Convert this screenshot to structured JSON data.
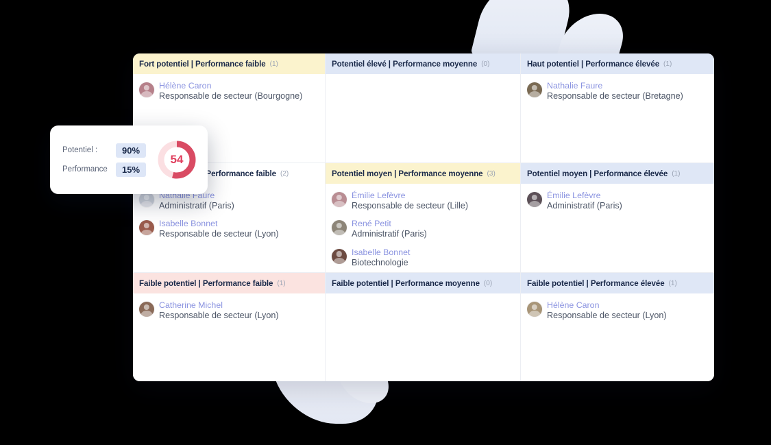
{
  "popup": {
    "potentiel_label": "Potentiel :",
    "potentiel_value": "90%",
    "performance_label": "Performance",
    "performance_value": "15%",
    "score": "54",
    "score_percent": 54,
    "gauge_track_color": "#fbdfe2",
    "gauge_arc_color": "#d94b63",
    "score_text_color": "#e0405f"
  },
  "matrix": {
    "cells": [
      {
        "id": "fort-potentiel-performance-faible",
        "title": "Fort potentiel | Performance faible",
        "count": "(1)",
        "tone": "yellow",
        "people": [
          {
            "name": "Hélène Caron",
            "role": "Responsable de secteur (Bourgogne)",
            "avatar_color": "#b6808a"
          }
        ]
      },
      {
        "id": "potentiel-eleve-performance-moyenne",
        "title": "Potentiel élevé | Performance moyenne",
        "count": "(0)",
        "tone": "blue",
        "people": []
      },
      {
        "id": "haut-potentiel-performance-elevee",
        "title": "Haut potentiel | Performance élevée",
        "count": "(1)",
        "tone": "blue",
        "people": [
          {
            "name": "Nathalie Faure",
            "role": "Responsable de secteur (Bretagne)",
            "avatar_color": "#7a6a53"
          }
        ]
      },
      {
        "id": "potentiel-moyen-performance-faible",
        "title": "Potentiel moyen | Performance faible",
        "count": "(2)",
        "tone": "plain",
        "people": [
          {
            "name": "Nathalie Faure",
            "role": "Administratif (Paris)",
            "avatar_color": "#4a4murky"
          },
          {
            "name": "Isabelle Bonnet",
            "role": "Responsable de secteur (Lyon)",
            "avatar_color": "#9a5b4c"
          }
        ]
      },
      {
        "id": "potentiel-moyen-performance-moyenne",
        "title": "Potentiel moyen | Performance moyenne",
        "count": "(3)",
        "tone": "yellow",
        "people": [
          {
            "name": "Émilie Lefèvre",
            "role": "Responsable de secteur (Lille)",
            "avatar_color": "#b98d93"
          },
          {
            "name": "René Petit",
            "role": "Administratif (Paris)",
            "avatar_color": "#8d8578"
          },
          {
            "name": "Isabelle Bonnet",
            "role": "Biotechnologie",
            "avatar_color": "#6d4b41"
          }
        ]
      },
      {
        "id": "potentiel-moyen-performance-elevee",
        "title": "Potentiel moyen | Performance élevée",
        "count": "(1)",
        "tone": "blue",
        "people": [
          {
            "name": "Émilie Lefèvre",
            "role": "Administratif (Paris)",
            "avatar_color": "#5c5057"
          }
        ]
      },
      {
        "id": "faible-potentiel-performance-faible",
        "title": "Faible potentiel | Performance faible",
        "count": "(1)",
        "tone": "pink",
        "people": [
          {
            "name": "Catherine Michel",
            "role": "Responsable de secteur (Lyon)",
            "avatar_color": "#8a6a58"
          }
        ]
      },
      {
        "id": "faible-potentiel-performance-moyenne",
        "title": "Faible potentiel | Performance moyenne",
        "count": "(0)",
        "tone": "blue",
        "people": []
      },
      {
        "id": "faible-potentiel-performance-elevee",
        "title": "Faible potentiel | Performance élevée",
        "count": "(1)",
        "tone": "blue",
        "people": [
          {
            "name": "Hélène Caron",
            "role": "Responsable de secteur (Lyon)",
            "avatar_color": "#a89578"
          }
        ]
      }
    ]
  },
  "colors": {
    "header_yellow": "#fbf3cd",
    "header_blue": "#dfe7f6",
    "header_pink": "#fbe3e0",
    "name_text": "#8a93e0",
    "role_text": "#4c5566",
    "title_text": "#1b2a4a",
    "background": "#000000"
  }
}
